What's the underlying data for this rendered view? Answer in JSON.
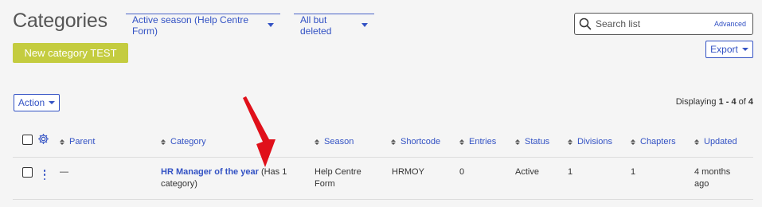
{
  "header": {
    "title": "Categories",
    "season_filter": "Active season (Help Centre Form)",
    "state_filter": "All but deleted"
  },
  "search": {
    "placeholder": "Search list",
    "advanced_label": "Advanced"
  },
  "toolbar": {
    "new_label": "New category TEST",
    "export_label": "Export",
    "action_label": "Action"
  },
  "pagination": {
    "prefix": "Displaying",
    "from": "1",
    "dash": " - ",
    "to": "4",
    "of_word": "of",
    "total": "4"
  },
  "table": {
    "columns": [
      "Parent",
      "Category",
      "Season",
      "Shortcode",
      "Entries",
      "Status",
      "Divisions",
      "Chapters",
      "Updated"
    ],
    "rows": [
      {
        "parent": "—",
        "category_name": "HR Manager of the year",
        "category_note_1": "(Has 1",
        "category_note_2": "category)",
        "season_1": "Help Centre",
        "season_2": "Form",
        "shortcode": "HRMOY",
        "entries": "0",
        "status": "Active",
        "divisions": "1",
        "chapters": "1",
        "updated_1": "4 months",
        "updated_2": "ago"
      }
    ]
  },
  "colors": {
    "accent": "#3352c4",
    "new_button": "#c4cc3f",
    "annotation_arrow": "#e0101a"
  },
  "icons": {
    "search": "search-icon",
    "settings": "gear-icon",
    "row_menu": "kebab-menu-icon",
    "sort": "sort-icon"
  }
}
